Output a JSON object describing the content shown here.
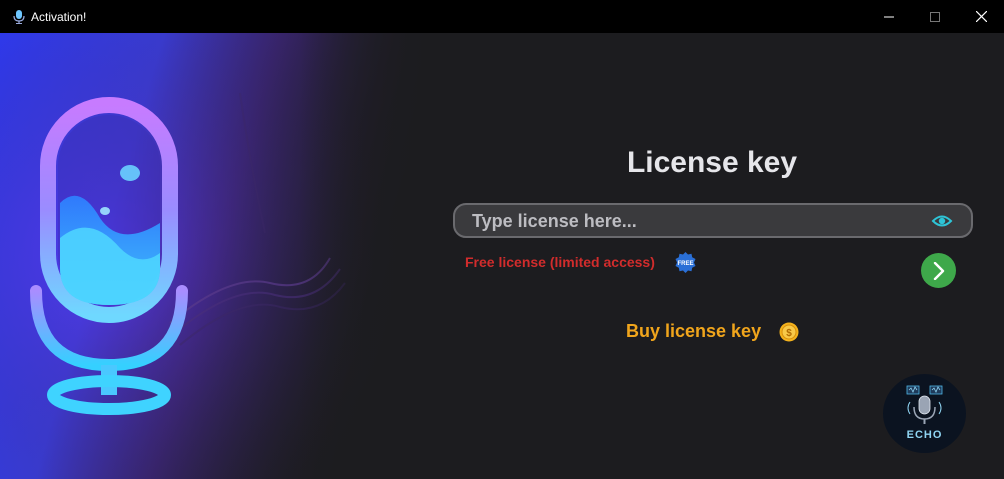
{
  "window": {
    "title": "Activation!"
  },
  "main": {
    "heading": "License key",
    "license_input": {
      "value": "",
      "placeholder": "Type license here..."
    },
    "free_link": "Free license (limited access)",
    "free_badge_text": "FREE",
    "buy_link": "Buy license key",
    "coin_symbol": "$",
    "logo_text": "ECHO"
  },
  "icons": {
    "app": "microphone-icon",
    "eye": "eye-icon",
    "next": "chevron-right-icon",
    "coin": "coin-icon",
    "badge": "free-badge-icon"
  },
  "colors": {
    "background": "#1c1c1f",
    "titlebar": "#000000",
    "heading": "#e6e6ea",
    "input_bg": "#3a3a3d",
    "free_link": "#d12c2c",
    "buy_link": "#f0a51c",
    "next_button": "#3ea84a",
    "eye_icon": "#2ec4d6",
    "badge": "#2a6fd6"
  }
}
